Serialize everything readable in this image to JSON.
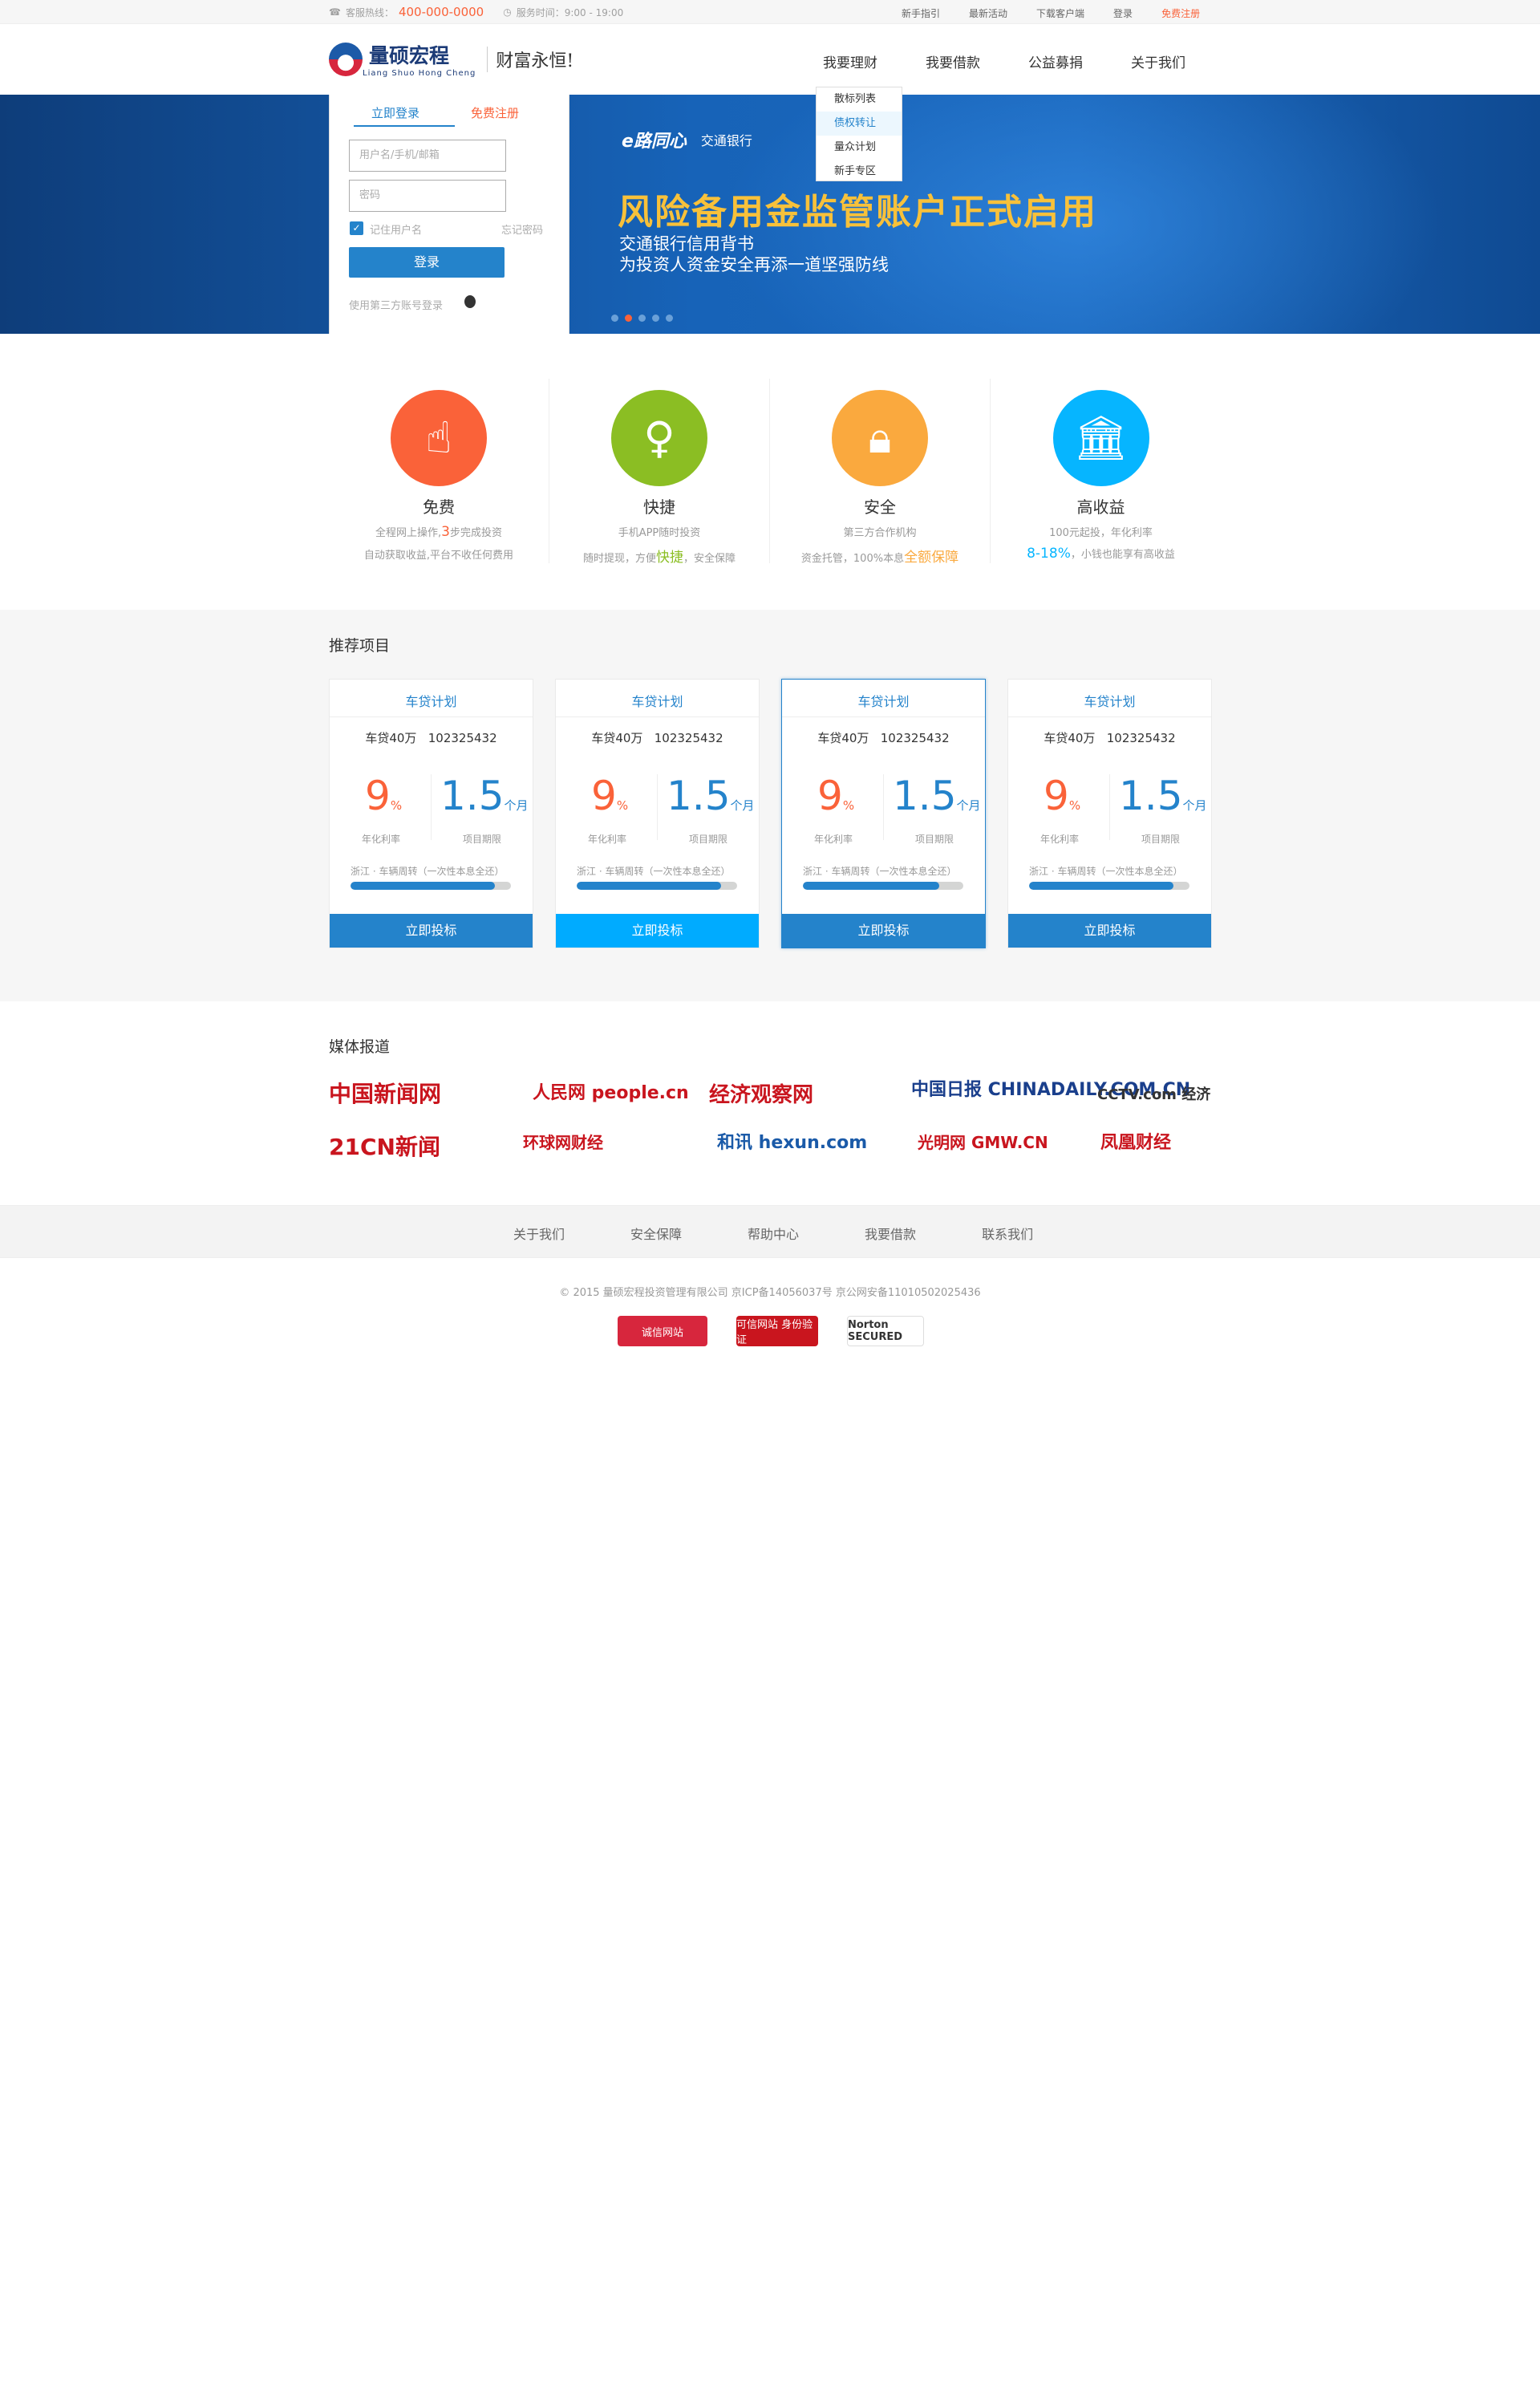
{
  "topbar": {
    "phone_label": "客服热线：",
    "phone": "400-000-0000",
    "service_time": "服务时间：9:00 - 19:00",
    "links": [
      "新手指引",
      "最新活动",
      "下载客户端",
      "登录",
      "免费注册"
    ]
  },
  "header": {
    "logo_cn": "量硕宏程",
    "logo_en": "Liang Shuo Hong Cheng",
    "slogan": "财富永恒!",
    "nav": [
      "我要理财",
      "我要借款",
      "公益募捐",
      "关于我们"
    ],
    "dropdown": [
      "散标列表",
      "债权转让",
      "量众计划",
      "新手专区"
    ]
  },
  "login": {
    "tab": "立即登录",
    "fast_register": "免费注册",
    "user_placeholder": "用户名/手机/邮箱",
    "pwd_placeholder": "密码",
    "remember": "记住用户名",
    "forgot": "忘记密码",
    "submit": "登录",
    "third_party": "使用第三方账号登录"
  },
  "banner": {
    "brand1": "e路同心",
    "brand2": "交通银行",
    "headline": "风险备用金监管账户正式启用",
    "sub1": "交通银行信用背书",
    "sub2": "为投资人资金安全再添一道坚强防线"
  },
  "features": [
    {
      "title": "免费",
      "line1a": "全程网上操作,",
      "line1b": "3",
      "line1c": "步完成投资",
      "line2": "自动获取收益,平台不收任何费用",
      "color": "#FA6239",
      "icon": "tap-icon"
    },
    {
      "title": "快捷",
      "line1a": "手机APP随时投资",
      "line1b": "",
      "line1c": "",
      "line2a": "随时提现，方便",
      "line2b": "快捷",
      "line2c": "，安全保障",
      "color": "#8BBE23",
      "icon": "person-icon"
    },
    {
      "title": "安全",
      "line1a": "第三方合作机构",
      "line1b": "",
      "line1c": "",
      "line2a": "资金托管，100%本息",
      "line2b": "全额保障",
      "line2c": "",
      "color": "#FAA93E",
      "icon": "lock-icon"
    },
    {
      "title": "高收益",
      "line1a": "100元起投，年化利率",
      "line1b": "",
      "line1c": "",
      "line2a": "",
      "line2b": "8-18%",
      "line2c": "，小钱也能享有高收益",
      "color": "#06B5FF",
      "icon": "bank-icon"
    }
  ],
  "recommend": {
    "title": "推荐项目",
    "cards": [
      {
        "name": "车贷计划",
        "amount": "车贷40万",
        "code": "102325432",
        "rate": "9",
        "rate_unit": "%",
        "term": "1.5",
        "term_unit": "个月",
        "rate_label": "年化利率",
        "term_label": "项目期限",
        "desc": "浙江 · 车辆周转（一次性本息全还）",
        "progress": 0.9,
        "cta": "立即投标",
        "active": false,
        "hl": false
      },
      {
        "name": "车贷计划",
        "amount": "车贷40万",
        "code": "102325432",
        "rate": "9",
        "rate_unit": "%",
        "term": "1.5",
        "term_unit": "个月",
        "rate_label": "年化利率",
        "term_label": "项目期限",
        "desc": "浙江 · 车辆周转（一次性本息全还）",
        "progress": 0.9,
        "cta": "立即投标",
        "active": false,
        "hl": true
      },
      {
        "name": "车贷计划",
        "amount": "车贷40万",
        "code": "102325432",
        "rate": "9",
        "rate_unit": "%",
        "term": "1.5",
        "term_unit": "个月",
        "rate_label": "年化利率",
        "term_label": "项目期限",
        "desc": "浙江 · 车辆周转（一次性本息全还）",
        "progress": 0.85,
        "cta": "立即投标",
        "active": true,
        "hl": false
      },
      {
        "name": "车贷计划",
        "amount": "车贷40万",
        "code": "102325432",
        "rate": "9",
        "rate_unit": "%",
        "term": "1.5",
        "term_unit": "个月",
        "rate_label": "年化利率",
        "term_label": "项目期限",
        "desc": "浙江 · 车辆周转（一次性本息全还）",
        "progress": 0.9,
        "cta": "立即投标",
        "active": false,
        "hl": false
      }
    ]
  },
  "media": {
    "title": "媒体报道",
    "logos": [
      "中国新闻网",
      "人民网 people.cn",
      "经济观察网",
      "中国日报 CHINADAILY.COM.CN",
      "CCTV.com 经济",
      "21CN新闻",
      "环球网财经",
      "和讯 hexun.com",
      "光明网 GMW.CN",
      "凤凰财经"
    ]
  },
  "footer": {
    "links": [
      "关于我们",
      "安全保障",
      "帮助中心",
      "我要借款",
      "联系我们"
    ],
    "copyright": "© 2015 量硕宏程投资管理有限公司 京ICP备14056037号 京公网安备11010502025436",
    "badges": [
      "诚信网站",
      "可信网站 身份验证",
      "Norton SECURED"
    ]
  }
}
